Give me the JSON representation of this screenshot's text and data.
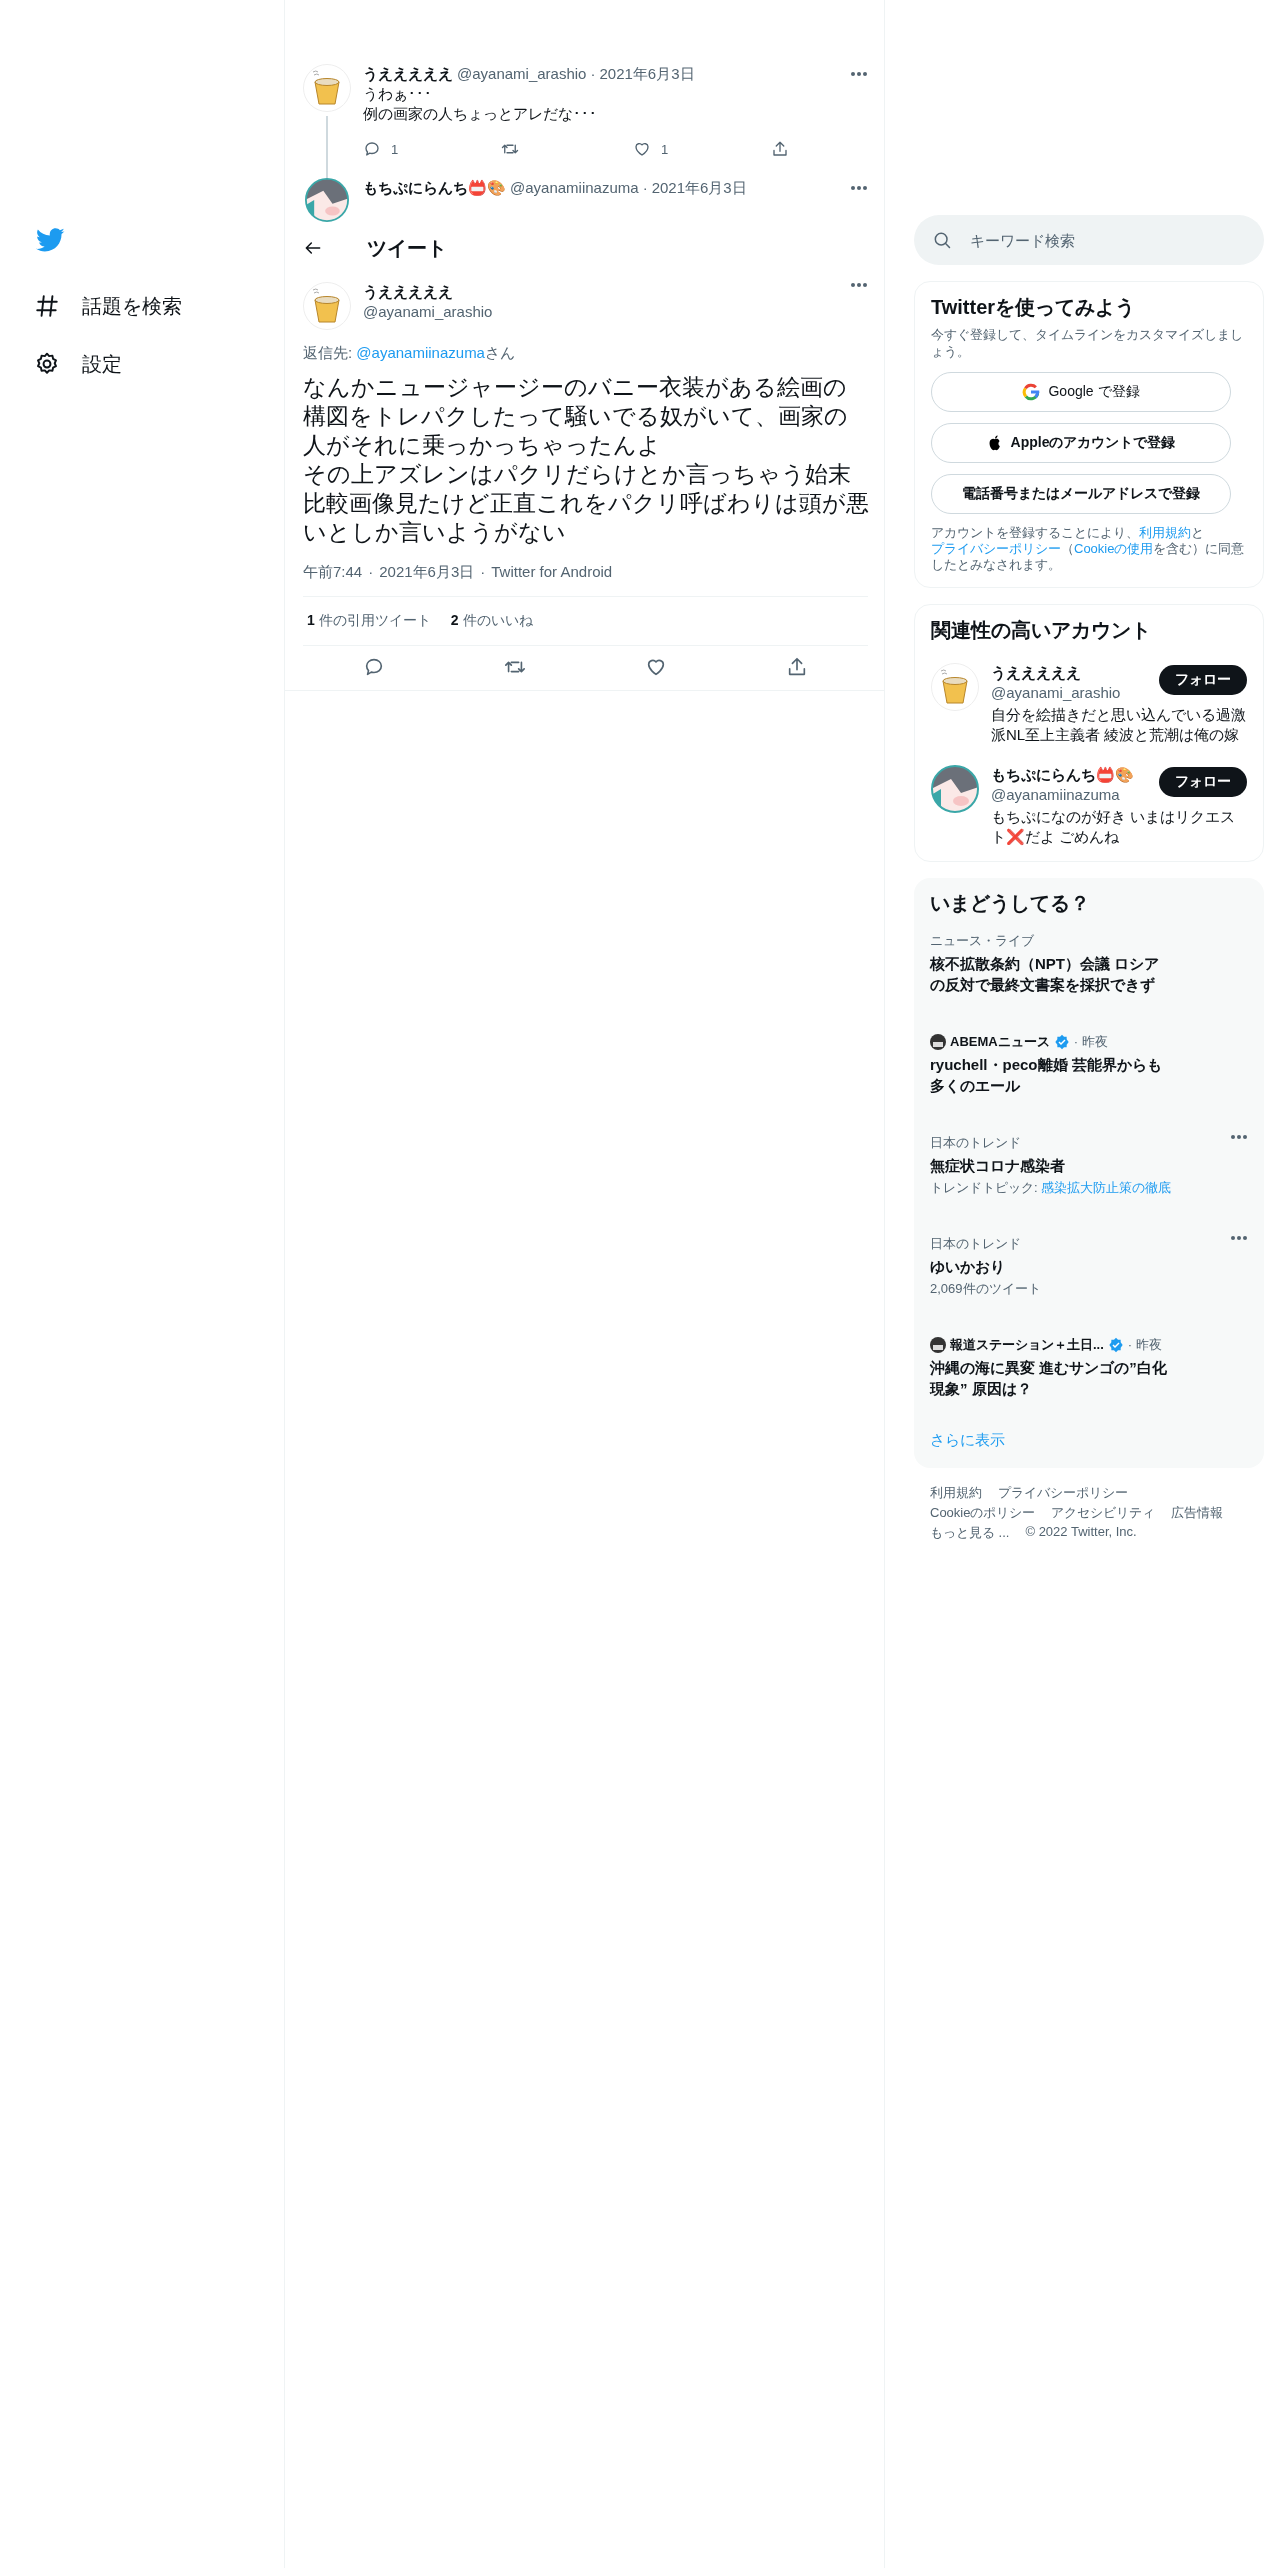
{
  "sidebar": {
    "items": [
      {
        "label": "話題を検索"
      },
      {
        "label": "設定"
      }
    ]
  },
  "thread": [
    {
      "name": "うえええええ",
      "handle": "@ayanami_arashio",
      "separator": "·",
      "date": "2021年6月3日",
      "lines": [
        "うわぁ･･･",
        "例の画家の人ちょっとアレだな･･･"
      ],
      "replies": "1",
      "likes": "1"
    },
    {
      "name": "もちぷにらんち📛🎨",
      "handle": "@ayanamiinazuma",
      "separator": "·",
      "date": "2021年6月3日"
    }
  ],
  "header": {
    "title": "ツイート"
  },
  "main_tweet": {
    "name": "うえええええ",
    "handle": "@ayanami_arashio",
    "reply_prefix": "返信先: ",
    "reply_mention": "@ayanamiinazuma",
    "reply_suffix": "さん",
    "paragraphs": [
      "なんかニュージャージーのバニー衣装がある絵画の構図をトレパクしたって騒いでる奴がいて、画家の人がそれに乗っかっちゃったんよ",
      "その上アズレンはパクリだらけとか言っちゃう始末",
      "比較画像見たけど正直これをパクリ呼ばわりは頭が悪いとしか言いようがない"
    ],
    "time": "午前7:44",
    "separator": "·",
    "date": "2021年6月3日",
    "source": "Twitter for Android",
    "stats": [
      {
        "count": "1",
        "label": "件の引用ツイート"
      },
      {
        "count": "2",
        "label": "件のいいね"
      }
    ]
  },
  "search": {
    "placeholder": "キーワード検索"
  },
  "signup": {
    "title": "Twitterを使ってみよう",
    "subtitle": "今すぐ登録して、タイムラインをカスタマイズしましょう。",
    "buttons": [
      {
        "kind": "google",
        "label": "Google で登録"
      },
      {
        "kind": "apple",
        "label": "Appleのアカウントで登録"
      },
      {
        "kind": "phone",
        "label": "電話番号またはメールアドレスで登録"
      }
    ],
    "legal": [
      {
        "text": "アカウントを登録することにより、",
        "link": false
      },
      {
        "text": "利用規約",
        "link": true
      },
      {
        "text": "と",
        "link": false
      },
      {
        "text": "プライバシーポリシー",
        "link": true
      },
      {
        "text": "（",
        "link": false
      },
      {
        "text": "Cookieの使用",
        "link": true
      },
      {
        "text": "を含む）に同意したとみなされます。",
        "link": false
      }
    ]
  },
  "who_to_follow": {
    "title": "関連性の高いアカウント",
    "accounts": [
      {
        "name": "うえええええ",
        "handle": "@ayanami_arashio",
        "bio": "自分を絵描きだと思い込んでいる過激派NL至上主義者 綾波と荒潮は俺の嫁",
        "button": "フォロー"
      },
      {
        "name": "もちぷにらんち📛🎨",
        "handle": "@ayanamiinazuma",
        "bio": "もちぷになのが好き いまはリクエスト❌だよ ごめんね",
        "button": "フォロー"
      }
    ]
  },
  "trends": {
    "title": "いまどうしてる？",
    "items": [
      {
        "kind": "news",
        "category": "ニュース・ライブ",
        "headline": "核不拡散条約（NPT）会議 ロシアの反対で最終文書案を採択できず"
      },
      {
        "kind": "source",
        "source": "ABEMAニュース",
        "verified": true,
        "time": "· 昨夜",
        "headline": "ryuchell・peco離婚 芸能界からも多くのエール"
      },
      {
        "kind": "trend",
        "category": "日本のトレンド",
        "headline": "無症状コロナ感染者",
        "topic_label": "トレンドトピック: ",
        "topic": "感染拡大防止策の徹底"
      },
      {
        "kind": "trend",
        "category": "日本のトレンド",
        "headline": "ゆいかおり",
        "count": "2,069件のツイート"
      },
      {
        "kind": "source",
        "source": "報道ステーション＋土日...",
        "verified": true,
        "time": "· 昨夜",
        "headline": "沖縄の海に異変 進むサンゴの”白化現象” 原因は？"
      }
    ],
    "show_more": "さらに表示"
  },
  "footer": {
    "links": [
      "利用規約",
      "プライバシーポリシー",
      "Cookieのポリシー",
      "アクセシビリティ",
      "広告情報",
      "もっと見る ..."
    ],
    "copyright": "© 2022 Twitter, Inc."
  }
}
